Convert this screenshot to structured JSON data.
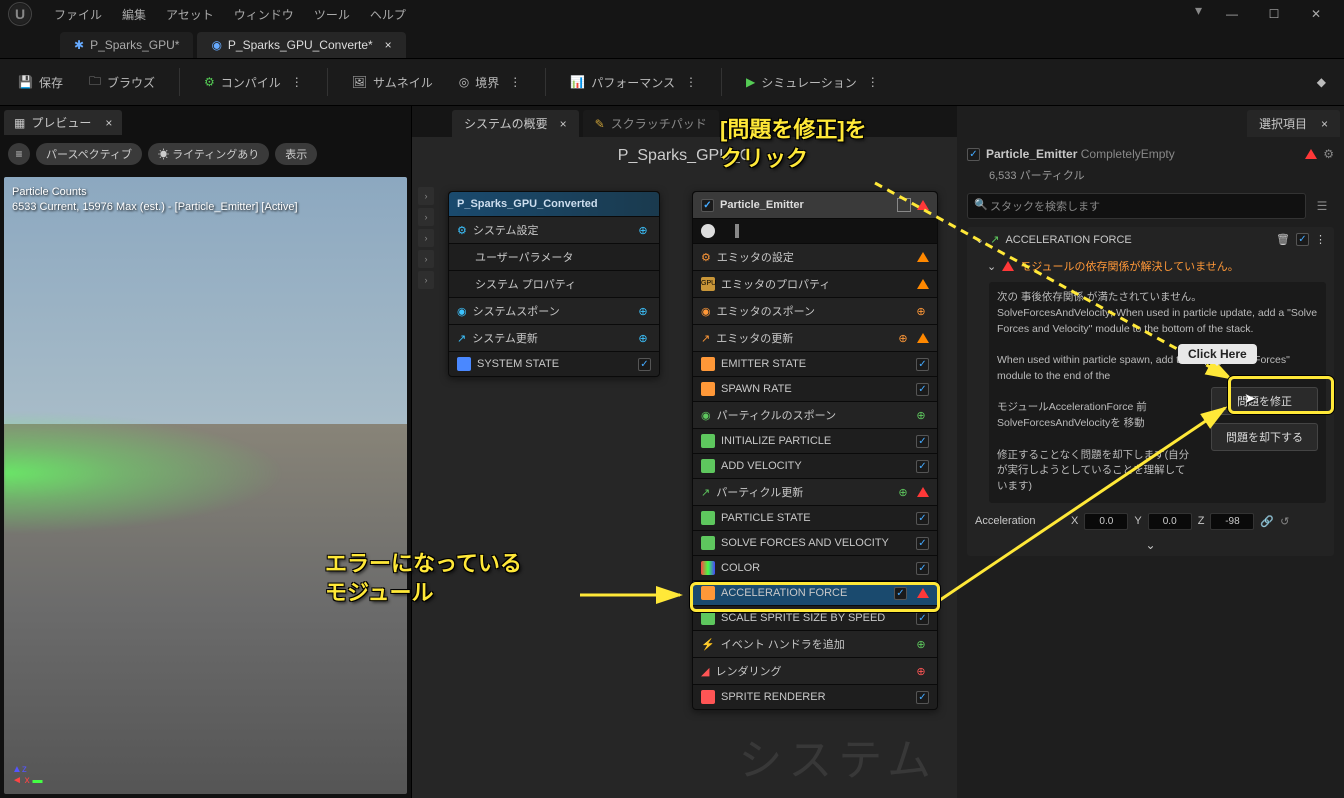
{
  "menu": {
    "file": "ファイル",
    "edit": "編集",
    "asset": "アセット",
    "window": "ウィンドウ",
    "tool": "ツール",
    "help": "ヘルプ"
  },
  "win": {
    "min": "—",
    "max": "☐",
    "close": "✕"
  },
  "tabs": {
    "t1": "P_Sparks_GPU*",
    "t2": "P_Sparks_GPU_Converte*",
    "close": "×"
  },
  "toolbar": {
    "save": "保存",
    "browse": "ブラウズ",
    "compile": "コンパイル",
    "thumbnail": "サムネイル",
    "bounds": "境界",
    "perf": "パフォーマンス",
    "sim": "シミュレーション"
  },
  "preview": {
    "tab": "プレビュー",
    "perspective": "パースペクティブ",
    "lighting": "ライティングあり",
    "show": "表示",
    "counts": "Particle Counts",
    "stats": "6533 Current, 15976 Max (est.) - [Particle_Emitter] [Active]"
  },
  "overview": {
    "tab": "システムの概要",
    "scratch": "スクラッチパッド",
    "title": "P_Sparks_GPU_C",
    "ghost": "システム"
  },
  "sysnode": {
    "title": "P_Sparks_GPU_Converted",
    "settings": "システム設定",
    "userparam": "ユーザーパラメータ",
    "sysprops": "システム プロパティ",
    "spawn": "システムスポーン",
    "update": "システム更新",
    "state": "SYSTEM STATE"
  },
  "emitnode": {
    "title": "Particle_Emitter",
    "emsettings": "エミッタの設定",
    "emprops": "エミッタのプロパティ",
    "emspawn": "エミッタのスポーン",
    "emupdate": "エミッタの更新",
    "emstate": "EMITTER STATE",
    "spawnrate": "SPAWN RATE",
    "pspawn": "パーティクルのスポーン",
    "initp": "INITIALIZE PARTICLE",
    "addvel": "ADD VELOCITY",
    "pupdate": "パーティクル更新",
    "pstate": "PARTICLE STATE",
    "solve": "SOLVE FORCES AND VELOCITY",
    "color": "COLOR",
    "accel": "ACCELERATION FORCE",
    "scale": "SCALE SPRITE SIZE BY SPEED",
    "event": "イベント ハンドラを追加",
    "render": "レンダリング",
    "sprite": "SPRITE RENDERER"
  },
  "selection": {
    "tab": "選択項目",
    "emitter": "Particle_Emitter",
    "mode": "CompletelyEmpty",
    "particles": "6,533 パーティクル",
    "search_ph": "スタックを検索します",
    "section": "ACCELERATION FORCE",
    "warn_title": "モジュールの依存関係が解決していません。",
    "warn_l1": "次の 事後依存関係 が満たされていません。",
    "warn_l2": "SolveForcesAndVelocity; When used in particle update, add a \"Solve Forces and Velocity\" module to the bottom of the stack.",
    "warn_l3": "When used within particle spawn, add the \"Apply Initial Forces\" module to the end of the",
    "warn_l4": "モジュールAccelerationForce 前 SolveForcesAndVelocityを 移動",
    "warn_l5": "修正することなく問題を却下します(自分が実行しようとしていることを理解しています)",
    "fix_btn": "問題を修正",
    "dismiss_btn": "問題を却下する",
    "accel_label": "Acceleration",
    "x": "0.0",
    "y": "0.0",
    "z": "-98"
  },
  "annot": {
    "top": "[問題を修正]を\nクリック",
    "left": "エラーになっている\nモジュール",
    "tooltip": "Click Here"
  }
}
